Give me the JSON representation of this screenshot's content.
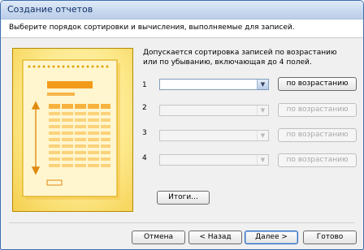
{
  "window": {
    "title": "Создание отчетов"
  },
  "header": {
    "instruction": "Выберите порядок сортировки и вычисления, выполняемые для записей."
  },
  "description": "Допускается сортировка записей по возрастанию или по убыванию, включающая до 4 полей.",
  "sort_rows": [
    {
      "number": "1",
      "field_value": "",
      "order_label": "по возрастанию",
      "enabled": true
    },
    {
      "number": "2",
      "field_value": "",
      "order_label": "по возрастанию",
      "enabled": false
    },
    {
      "number": "3",
      "field_value": "",
      "order_label": "по возрастанию",
      "enabled": false
    },
    {
      "number": "4",
      "field_value": "",
      "order_label": "по возрастанию",
      "enabled": false
    }
  ],
  "summary_button": "Итоги...",
  "footer": {
    "cancel": "Отмена",
    "back": "< Назад",
    "next": "Далее >",
    "finish": "Готово"
  },
  "colors": {
    "accent": "#3f6fae",
    "illustration": "#f4cf4e"
  },
  "icons": {
    "dropdown": "chevron-down-icon"
  }
}
